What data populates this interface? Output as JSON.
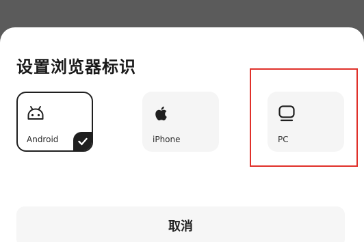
{
  "dialog": {
    "title": "设置浏览器标识"
  },
  "options": [
    {
      "label": "Android",
      "icon": "android-icon",
      "selected": true
    },
    {
      "label": "iPhone",
      "icon": "apple-icon",
      "selected": false
    },
    {
      "label": "PC",
      "icon": "monitor-icon",
      "selected": false
    }
  ],
  "cancel_label": "取消",
  "colors": {
    "overlay": "#5b5b5b",
    "sheet": "#ffffff",
    "card": "#f5f5f5",
    "selected_border": "#1f1f1f",
    "highlight": "#e0302a"
  }
}
